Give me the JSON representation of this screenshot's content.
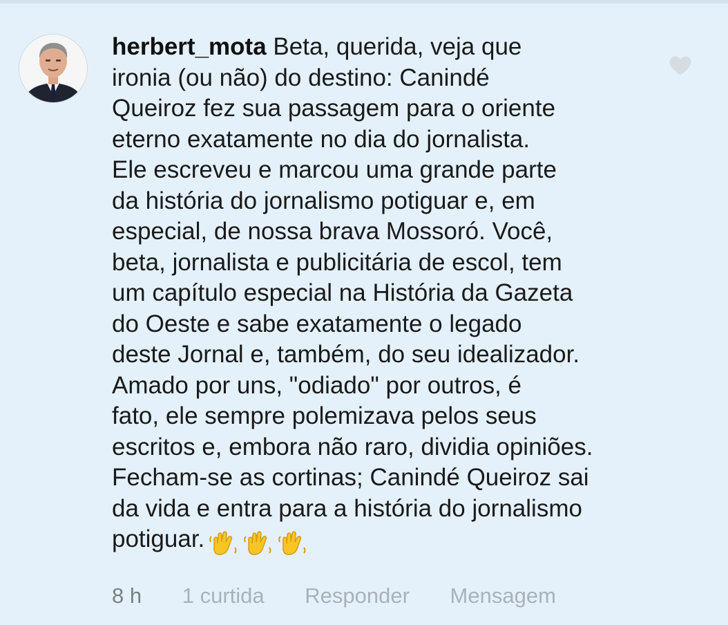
{
  "comment": {
    "username": "herbert_mota",
    "text": "Beta, querida, veja que\nironia (ou não) do destino: Canindé\nQueiroz fez sua passagem para o oriente\neterno exatamente no dia do jornalista.\nEle escreveu e marcou uma grande parte\nda história do jornalismo potiguar e, em\nespecial, de nossa brava Mossoró. Você,\nbeta, jornalista e publicitária de escol, tem\num capítulo especial na História da Gazeta\ndo Oeste e sabe exatamente o legado\ndeste Jornal e, também, do seu idealizador.\nAmado por uns, \"odiado\" por outros, é\nfato, ele sempre polemizava pelos seus\nescritos e, embora não raro, dividia opiniões.\nFecham-se as cortinas; Canindé Queiroz sai\nda vida e entra para a história do jornalismo\npotiguar.",
    "emojis": [
      "clapping-hands-emoji",
      "clapping-hands-emoji",
      "clapping-hands-emoji"
    ],
    "like_icon": "heart-outline-icon",
    "avatar_icon": "profile-photo"
  },
  "meta": {
    "time": "8 h",
    "likes": "1 curtida",
    "reply": "Responder",
    "message": "Mensagem"
  },
  "colors": {
    "background": "#e4f1fb",
    "text": "#1a1a1a",
    "muted": "#a9b2b9",
    "time": "#7a7f84"
  }
}
